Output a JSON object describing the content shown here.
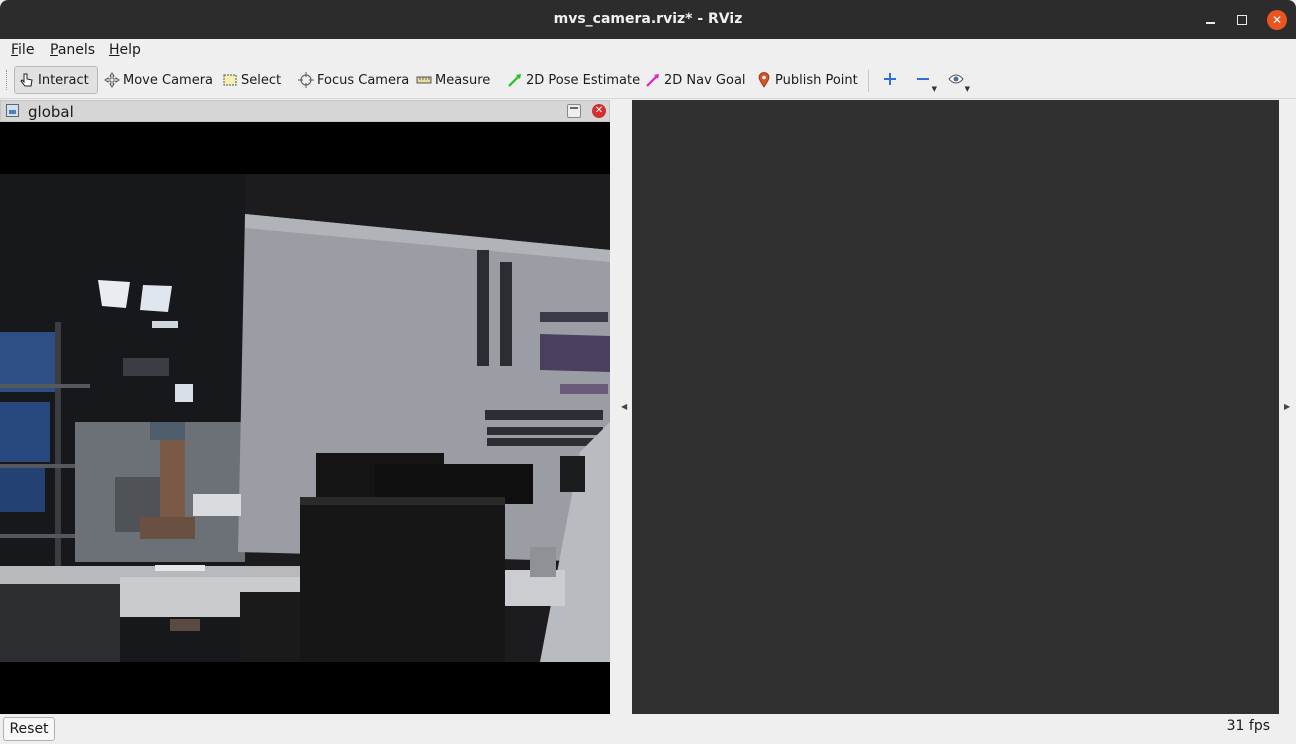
{
  "window": {
    "title": "mvs_camera.rviz* - RViz"
  },
  "menu": [
    {
      "label": "File",
      "mnemonic": "F",
      "rest": "ile"
    },
    {
      "label": "Panels",
      "mnemonic": "P",
      "rest": "anels"
    },
    {
      "label": "Help",
      "mnemonic": "H",
      "rest": "elp"
    }
  ],
  "toolbar": {
    "interact": "Interact",
    "move_camera": "Move Camera",
    "select": "Select",
    "focus_camera": "Focus Camera",
    "measure": "Measure",
    "pose_estimate": "2D Pose Estimate",
    "nav_goal": "2D Nav Goal",
    "publish_point": "Publish Point"
  },
  "image_panel": {
    "title": "global"
  },
  "status": {
    "reset_label": "Reset",
    "fps": "31 fps"
  },
  "colors": {
    "pose_estimate_accent": "#1ec31e",
    "nav_goal_accent": "#e020c8",
    "publish_point_accent": "#d6532a",
    "render_bg": "#303030",
    "close_accent": "#e95420"
  }
}
